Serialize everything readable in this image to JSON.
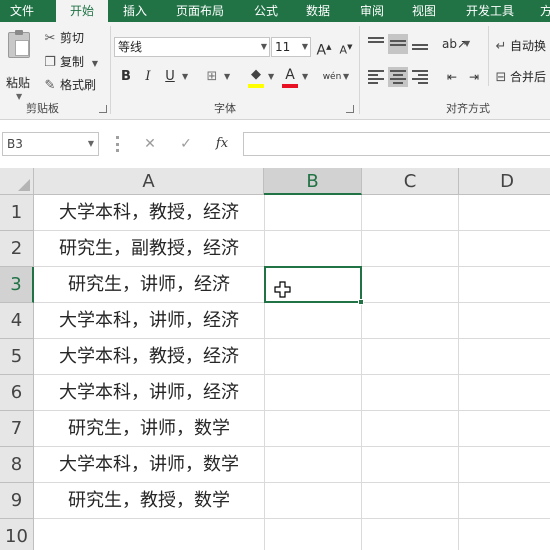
{
  "tabs": [
    "文件",
    "开始",
    "插入",
    "页面布局",
    "公式",
    "数据",
    "审阅",
    "视图",
    "开发工具",
    "方"
  ],
  "active_tab": "开始",
  "ribbon": {
    "clipboard": {
      "paste_label": "粘贴",
      "cut_label": "剪切",
      "copy_label": "复制",
      "format_painter_label": "格式刷",
      "group_label": "剪贴板"
    },
    "font": {
      "font_name": "等线",
      "font_size": "11",
      "grow_label": "A",
      "shrink_label": "A",
      "bold": "B",
      "italic": "I",
      "underline": "U",
      "font_color_label": "A",
      "phonetic_label": "wén",
      "group_label": "字体"
    },
    "alignment": {
      "wrap_text_label": "自动换",
      "merge_center_label": "合并后",
      "group_label": "对齐方式"
    }
  },
  "formula_bar": {
    "name_box": "B3",
    "cancel_icon": "✕",
    "enter_icon": "✓",
    "fx_label": "fx",
    "formula": ""
  },
  "sheet": {
    "columns": [
      "A",
      "B",
      "C",
      "D"
    ],
    "rows": [
      "1",
      "2",
      "3",
      "4",
      "5",
      "6",
      "7",
      "8",
      "9",
      "10"
    ],
    "column_a": [
      "大学本科，教授，经济",
      "研究生，副教授，经济",
      "研究生，讲师，经济",
      "大学本科，讲师，经济",
      "大学本科，教授，经济",
      "大学本科，讲师，经济",
      "研究生，讲师，数学",
      "大学本科，讲师，数学",
      "研究生，教授，数学",
      ""
    ],
    "selected_cell": "B3",
    "accent_color": "#217346"
  }
}
